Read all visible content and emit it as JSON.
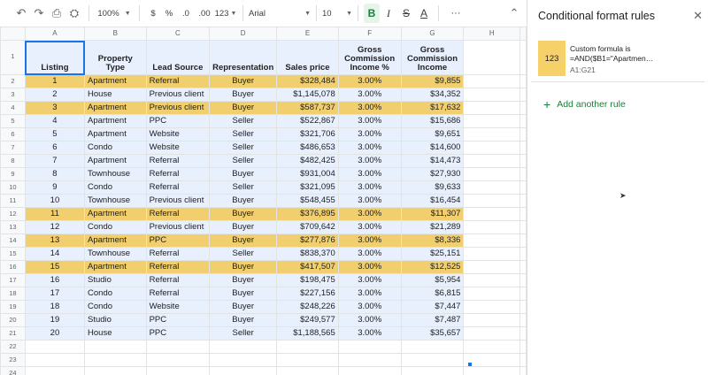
{
  "toolbar": {
    "zoom": "100%",
    "currency": "$",
    "percent": "%",
    "decrease_decimal": ".0",
    "increase_decimal": ".00",
    "number_format": "123",
    "font": "Arial",
    "font_size": "10",
    "bold": "B",
    "italic": "I",
    "strike": "S",
    "text_color": "A",
    "more": "···"
  },
  "columns": [
    "A",
    "B",
    "C",
    "D",
    "E",
    "F",
    "G",
    "H"
  ],
  "header_row": [
    "Listing",
    "Property Type",
    "Lead Source",
    "Representation",
    "Sales price",
    "Gross Commission Income %",
    "Gross Commission Income"
  ],
  "rows": [
    {
      "cells": [
        "1",
        "Apartment",
        "Referral",
        "Buyer",
        "$328,484",
        "3.00%",
        "$9,855"
      ],
      "hl": true
    },
    {
      "cells": [
        "2",
        "House",
        "Previous client",
        "Buyer",
        "$1,145,078",
        "3.00%",
        "$34,352"
      ],
      "hl": false
    },
    {
      "cells": [
        "3",
        "Apartment",
        "Previous client",
        "Buyer",
        "$587,737",
        "3.00%",
        "$17,632"
      ],
      "hl": true
    },
    {
      "cells": [
        "4",
        "Apartment",
        "PPC",
        "Seller",
        "$522,867",
        "3.00%",
        "$15,686"
      ],
      "hl": false
    },
    {
      "cells": [
        "5",
        "Apartment",
        "Website",
        "Seller",
        "$321,706",
        "3.00%",
        "$9,651"
      ],
      "hl": false
    },
    {
      "cells": [
        "6",
        "Condo",
        "Website",
        "Seller",
        "$486,653",
        "3.00%",
        "$14,600"
      ],
      "hl": false
    },
    {
      "cells": [
        "7",
        "Apartment",
        "Referral",
        "Seller",
        "$482,425",
        "3.00%",
        "$14,473"
      ],
      "hl": false
    },
    {
      "cells": [
        "8",
        "Townhouse",
        "Referral",
        "Buyer",
        "$931,004",
        "3.00%",
        "$27,930"
      ],
      "hl": false
    },
    {
      "cells": [
        "9",
        "Condo",
        "Referral",
        "Seller",
        "$321,095",
        "3.00%",
        "$9,633"
      ],
      "hl": false
    },
    {
      "cells": [
        "10",
        "Townhouse",
        "Previous client",
        "Buyer",
        "$548,455",
        "3.00%",
        "$16,454"
      ],
      "hl": false
    },
    {
      "cells": [
        "11",
        "Apartment",
        "Referral",
        "Buyer",
        "$376,895",
        "3.00%",
        "$11,307"
      ],
      "hl": true
    },
    {
      "cells": [
        "12",
        "Condo",
        "Previous client",
        "Buyer",
        "$709,642",
        "3.00%",
        "$21,289"
      ],
      "hl": false
    },
    {
      "cells": [
        "13",
        "Apartment",
        "PPC",
        "Buyer",
        "$277,876",
        "3.00%",
        "$8,336"
      ],
      "hl": true
    },
    {
      "cells": [
        "14",
        "Townhouse",
        "Referral",
        "Seller",
        "$838,370",
        "3.00%",
        "$25,151"
      ],
      "hl": false
    },
    {
      "cells": [
        "15",
        "Apartment",
        "Referral",
        "Buyer",
        "$417,507",
        "3.00%",
        "$12,525"
      ],
      "hl": true
    },
    {
      "cells": [
        "16",
        "Studio",
        "Referral",
        "Buyer",
        "$198,475",
        "3.00%",
        "$5,954"
      ],
      "hl": false
    },
    {
      "cells": [
        "17",
        "Condo",
        "Referral",
        "Buyer",
        "$227,156",
        "3.00%",
        "$6,815"
      ],
      "hl": false
    },
    {
      "cells": [
        "18",
        "Condo",
        "Website",
        "Buyer",
        "$248,226",
        "3.00%",
        "$7,447"
      ],
      "hl": false
    },
    {
      "cells": [
        "19",
        "Studio",
        "PPC",
        "Buyer",
        "$249,577",
        "3.00%",
        "$7,487"
      ],
      "hl": false
    },
    {
      "cells": [
        "20",
        "House",
        "PPC",
        "Seller",
        "$1,188,565",
        "3.00%",
        "$35,657"
      ],
      "hl": false
    }
  ],
  "empty_rows": [
    "22",
    "23",
    "24"
  ],
  "sidebar": {
    "title": "Conditional format rules",
    "rule": {
      "preview": "123",
      "line1": "Custom formula is",
      "line2": "=AND($B1=\"Apartmen…",
      "range": "A1:G21"
    },
    "add_rule": "Add another rule"
  },
  "colors": {
    "highlight": "#f1cf6e",
    "selection": "#e8f0fe",
    "accent": "#188038",
    "swatch": "#f6d169"
  }
}
